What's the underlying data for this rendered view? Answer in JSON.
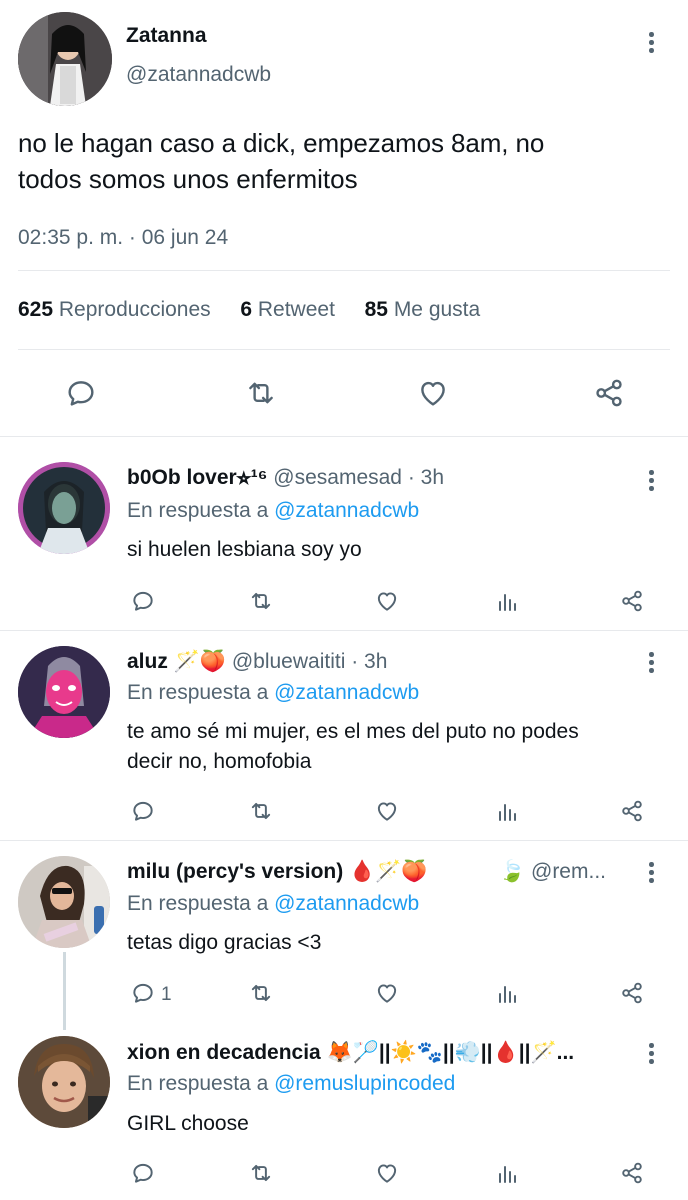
{
  "main_tweet": {
    "author_name": "Zatanna",
    "handle": "@zatannadcwb",
    "text_line1": "no le hagan caso a dick, empezamos 8am, no",
    "text_line2": "todos somos unos enfermitos",
    "timestamp": "02:35 p. m. · 06 jun 24",
    "stats": {
      "views_count": "625",
      "views_label": "Reproducciones",
      "retweets_count": "6",
      "retweets_label": "Retweet",
      "likes_count": "85",
      "likes_label": "Me gusta"
    },
    "actions": [
      "reply-icon",
      "retweet-icon",
      "like-icon",
      "share-icon"
    ]
  },
  "replies": [
    {
      "name": "b0Ob lover⭐︎¹⁶",
      "handle_time": "@sesamesad · 3h",
      "reply_prefix": "En respuesta a",
      "reply_to": "@zatannadcwb",
      "text_line1": "si huelen lesbiana soy yo",
      "text_line2": "",
      "reply_count": ""
    },
    {
      "name": "aluz 🪄🍑",
      "handle_time": "@bluewaititi · 3h",
      "reply_prefix": "En respuesta a",
      "reply_to": "@zatannadcwb",
      "text_line1": "te amo sé mi mujer, es el mes del puto no podes",
      "text_line2": "decir no, homofobia",
      "reply_count": ""
    },
    {
      "name": "milu (percy's version) 🩸🪄🍑",
      "name_extra": "🍃",
      "handle_time": "@rem...",
      "reply_prefix": "En respuesta a",
      "reply_to": "@zatannadcwb",
      "text_line1": "tetas digo gracias <3",
      "text_line2": "",
      "reply_count": "1"
    },
    {
      "name": "xion en decadencia 🦊🏸||☀️🐾||💨||🩸||🪄...",
      "handle_time": "",
      "reply_prefix": "En respuesta a",
      "reply_to": "@remuslupincoded",
      "text_line1": "GIRL choose",
      "text_line2": "",
      "reply_count": ""
    }
  ],
  "colors": {
    "text": "#0f1419",
    "secondary": "#536471",
    "link": "#1d9bf0",
    "divider": "#e7e9ec"
  }
}
